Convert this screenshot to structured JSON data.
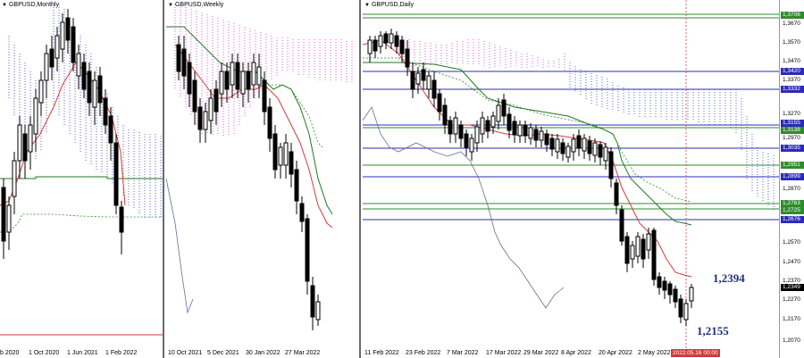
{
  "panels": {
    "monthly": {
      "title": "GBPUSD,Monthly",
      "xlabels": [
        "b 2020",
        "1 Oct 2020",
        "1 Jun 2021",
        "1 Feb 2022"
      ]
    },
    "weekly": {
      "title": "GBPUSD,Weekly",
      "xlabels": [
        "10 Oct 2021",
        "5 Dec 2021",
        "30 Jan 2022",
        "27 Mar 2022"
      ]
    },
    "daily": {
      "title": "GBPUSD,Daily",
      "xlabels": [
        "11 Feb 2022",
        "23 Feb 2022",
        "7 Mar 2022",
        "17 Mar 2022",
        "29 Mar 2022",
        "8 Apr 2022",
        "20 Apr 2022",
        "2 May 2022"
      ],
      "date_tag": "2022.05.16 00:00"
    }
  },
  "price_scale": {
    "labels": [
      "1,3670",
      "1,3570",
      "1,3470",
      "1,3370",
      "1,3270",
      "1,2970",
      "1,2870",
      "1,2570",
      "1,2470",
      "1,2370",
      "1,2270",
      "1,2170",
      "1,2070"
    ],
    "tags": [
      {
        "value": "1,3706",
        "color": "#2e8b2e"
      },
      {
        "value": "1,3420",
        "color": "#2b2bb8"
      },
      {
        "value": "1,3332",
        "color": "#2b2bb8"
      },
      {
        "value": "1,3155",
        "color": "#2b2bb8"
      },
      {
        "value": "1,3138",
        "color": "#2e8b2e"
      },
      {
        "value": "1,3035",
        "color": "#2b2bb8"
      },
      {
        "value": "1,2951",
        "color": "#2e8b2e"
      },
      {
        "value": "1,2899",
        "color": "#2b2bb8"
      },
      {
        "value": "1,2763",
        "color": "#2e8b2e"
      },
      {
        "value": "1,2725",
        "color": "#2e8b2e"
      },
      {
        "value": "1,2676",
        "color": "#2b2bb8"
      },
      {
        "value": "1,2349",
        "color": "#000000"
      }
    ]
  },
  "annotations": {
    "upper": "1,2394",
    "lower": "1,2155"
  }
}
